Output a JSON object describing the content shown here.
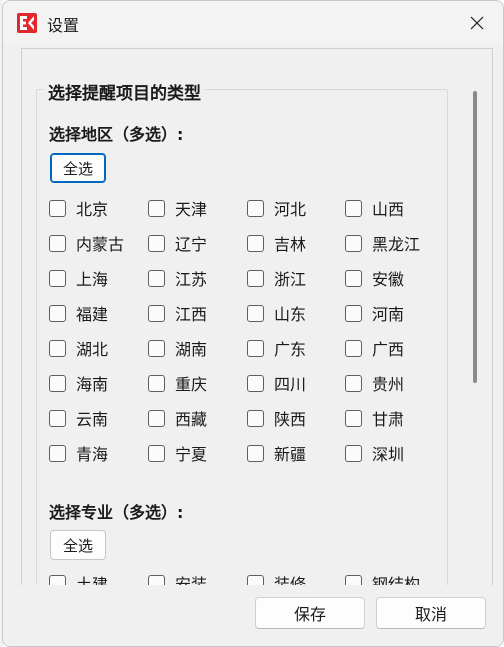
{
  "window": {
    "title": "设置",
    "app_icon": "app-logo-icon",
    "close_icon": "close-icon"
  },
  "group": {
    "title": "选择提醒项目的类型"
  },
  "region": {
    "label": "选择地区（多选）:",
    "select_all": "全选",
    "items": [
      "北京",
      "天津",
      "河北",
      "山西",
      "内蒙古",
      "辽宁",
      "吉林",
      "黑龙江",
      "上海",
      "江苏",
      "浙江",
      "安徽",
      "福建",
      "江西",
      "山东",
      "河南",
      "湖北",
      "湖南",
      "广东",
      "广西",
      "海南",
      "重庆",
      "四川",
      "贵州",
      "云南",
      "西藏",
      "陕西",
      "甘肃",
      "青海",
      "宁夏",
      "新疆",
      "深圳"
    ]
  },
  "specialty": {
    "label": "选择专业（多选）:",
    "select_all": "全选",
    "items": [
      "土建",
      "安装",
      "装修",
      "钢结构"
    ]
  },
  "buttons": {
    "save": "保存",
    "cancel": "取消"
  },
  "colors": {
    "focus_accent": "#0067c0",
    "logo_red": "#e0282e"
  }
}
